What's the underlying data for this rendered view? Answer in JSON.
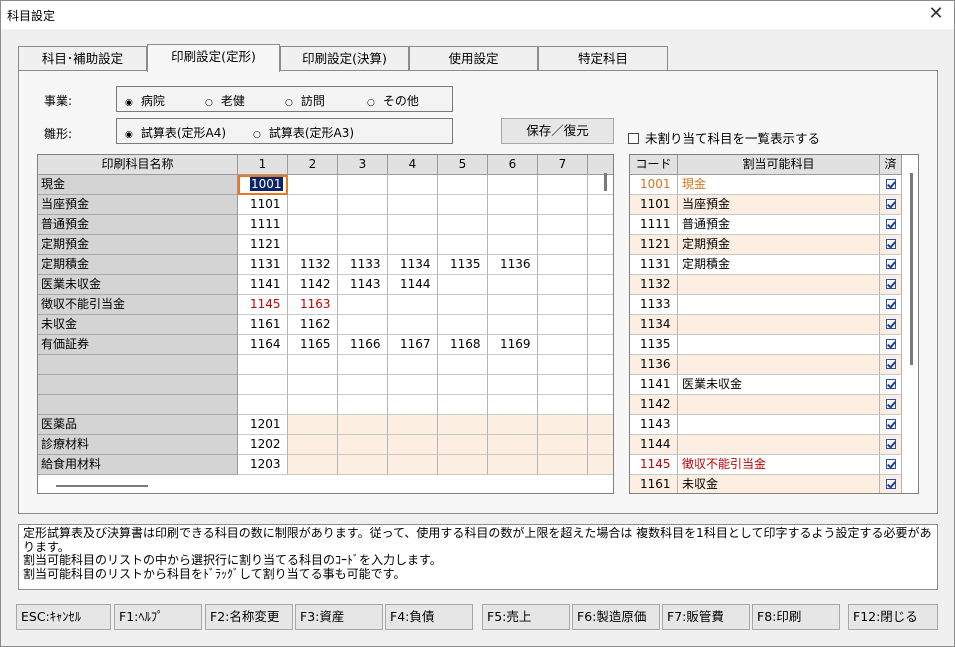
{
  "window": {
    "title": "科目設定",
    "close_glyph": "✕"
  },
  "tabs": [
    "科目･補助設定",
    "印刷設定(定形)",
    "印刷設定(決算)",
    "使用設定",
    "特定科目"
  ],
  "active_tab": 1,
  "business": {
    "label": "事業:",
    "options": [
      "病院",
      "老健",
      "訪問",
      "その他"
    ],
    "selected": 0
  },
  "template": {
    "label": "雛形:",
    "options": [
      "試算表(定形A4)",
      "試算表(定形A3)"
    ],
    "selected": 0
  },
  "save_button": "保存／復元",
  "unassigned_checkbox": {
    "label": "未割り当て科目を一覧表示する",
    "checked": false
  },
  "print_grid": {
    "name_header": "印刷科目名称",
    "columns": [
      "1",
      "2",
      "3",
      "4",
      "5",
      "6",
      "7"
    ],
    "rows": [
      {
        "name": "現金",
        "codes": [
          "1001"
        ],
        "red": false,
        "peach": false
      },
      {
        "name": "当座預金",
        "codes": [
          "1101"
        ],
        "red": false,
        "peach": false
      },
      {
        "name": "普通預金",
        "codes": [
          "1111"
        ],
        "red": false,
        "peach": false
      },
      {
        "name": "定期預金",
        "codes": [
          "1121"
        ],
        "red": false,
        "peach": false
      },
      {
        "name": "定期積金",
        "codes": [
          "1131",
          "1132",
          "1133",
          "1134",
          "1135",
          "1136"
        ],
        "red": false,
        "peach": false
      },
      {
        "name": "医業未収金",
        "codes": [
          "1141",
          "1142",
          "1143",
          "1144"
        ],
        "red": false,
        "peach": false
      },
      {
        "name": "徴収不能引当金",
        "codes": [
          "1145",
          "1163"
        ],
        "red": true,
        "peach": false
      },
      {
        "name": "未収金",
        "codes": [
          "1161",
          "1162"
        ],
        "red": false,
        "peach": false
      },
      {
        "name": "有価証券",
        "codes": [
          "1164",
          "1165",
          "1166",
          "1167",
          "1168",
          "1169"
        ],
        "red": false,
        "peach": false
      },
      {
        "name": "",
        "codes": [],
        "red": false,
        "peach": false
      },
      {
        "name": "",
        "codes": [],
        "red": false,
        "peach": false
      },
      {
        "name": "",
        "codes": [],
        "red": false,
        "peach": false
      },
      {
        "name": "医薬品",
        "codes": [
          "1201"
        ],
        "red": false,
        "peach": true
      },
      {
        "name": "診療材料",
        "codes": [
          "1202"
        ],
        "red": false,
        "peach": true
      },
      {
        "name": "給食用材料",
        "codes": [
          "1203"
        ],
        "red": false,
        "peach": true
      }
    ]
  },
  "assign_list": {
    "headers": [
      "コード",
      "割当可能科目",
      "済"
    ],
    "rows": [
      {
        "code": "1001",
        "name": "現金",
        "color": "orange",
        "peach": false
      },
      {
        "code": "1101",
        "name": "当座預金",
        "color": "",
        "peach": true
      },
      {
        "code": "1111",
        "name": "普通預金",
        "color": "",
        "peach": false
      },
      {
        "code": "1121",
        "name": "定期預金",
        "color": "",
        "peach": true
      },
      {
        "code": "1131",
        "name": "定期積金",
        "color": "",
        "peach": false
      },
      {
        "code": "1132",
        "name": "",
        "color": "",
        "peach": true
      },
      {
        "code": "1133",
        "name": "",
        "color": "",
        "peach": false
      },
      {
        "code": "1134",
        "name": "",
        "color": "",
        "peach": true
      },
      {
        "code": "1135",
        "name": "",
        "color": "",
        "peach": false
      },
      {
        "code": "1136",
        "name": "",
        "color": "",
        "peach": true
      },
      {
        "code": "1141",
        "name": "医業未収金",
        "color": "",
        "peach": false
      },
      {
        "code": "1142",
        "name": "",
        "color": "",
        "peach": true
      },
      {
        "code": "1143",
        "name": "",
        "color": "",
        "peach": false
      },
      {
        "code": "1144",
        "name": "",
        "color": "",
        "peach": true
      },
      {
        "code": "1145",
        "name": "徴収不能引当金",
        "color": "red",
        "peach": false
      },
      {
        "code": "1161",
        "name": "未収金",
        "color": "",
        "peach": true
      }
    ]
  },
  "message": [
    "定形試算表及び決算書は印刷できる科目の数に制限があります。従って、使用する科目の数が上限を超えた場合は 複数科目を1科目として印字するよう設定する必要があります。",
    "割当可能科目のリストの中から選択行に割り当てる科目のｺｰﾄﾞを入力します。",
    "割当可能科目のリストから科目をﾄﾞﾗｯｸﾞして割り当てる事も可能です。"
  ],
  "footer_buttons": [
    "ESC:ｷｬﾝｾﾙ",
    "F1:ﾍﾙﾌﾟ",
    "F2:名称変更",
    "F3:資産",
    "F4:負債",
    "F5:売上",
    "F6:製造原価",
    "F7:販管費",
    "F8:印刷",
    "F12:閉じる"
  ],
  "colors": {
    "selection_outline": "#e87722",
    "peach": "#fdeee2",
    "red_text": "#c00000",
    "orange_text": "#d8731c"
  }
}
